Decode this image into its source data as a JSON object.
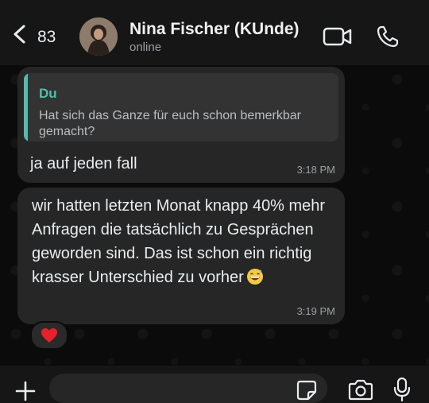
{
  "header": {
    "back_count": "83",
    "contact_name": "Nina Fischer (KUnde)",
    "status": "online",
    "icons": [
      "back-arrow-icon",
      "video-call-icon",
      "phone-icon"
    ]
  },
  "messages": [
    {
      "reply_to": {
        "author": "Du",
        "text": "Hat sich das Ganze für euch schon bemerkbar gemacht?"
      },
      "text": "ja auf jeden fall",
      "time": "3:18 PM"
    },
    {
      "text": "wir hatten letzten Monat knapp 40% mehr Anfragen die tatsächlich zu Gesprächen geworden sind. Das ist schon ein richtig krasser Unterschied zu vorher",
      "emoji": "grinning-sweat-emoji",
      "time": "3:19 PM",
      "reaction": "red-heart"
    }
  ],
  "input": {
    "placeholder": "",
    "icons": [
      "plus-icon",
      "sticker-icon",
      "camera-icon",
      "microphone-icon"
    ]
  },
  "colors": {
    "background": "#0b0b0b",
    "bubble": "#262626",
    "quote_accent": "#53bdab",
    "text": "#e9edef",
    "muted": "#9aa0a4"
  }
}
